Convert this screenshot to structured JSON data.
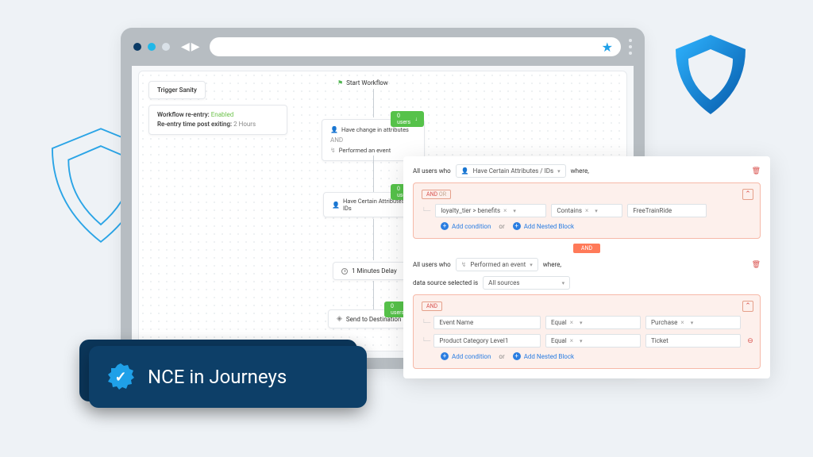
{
  "title_card": {
    "label": "NCE in Journeys"
  },
  "workflow": {
    "trigger_label": "Trigger Sanity",
    "reentry_label": "Workflow re-entry:",
    "reentry_value": "Enabled",
    "reentry_time_label": "Re-entry time post exiting:",
    "reentry_time_value": "2 Hours",
    "start_label": "Start Workflow",
    "node1": {
      "users_count": "0 users",
      "line1": "Have change in attributes",
      "logic": "AND",
      "line2": "Performed an event"
    },
    "node2": {
      "users_count": "0 users",
      "line1": "Have Certain Attributes / IDs"
    },
    "node3": {
      "label": "1 Minutes Delay"
    },
    "node4": {
      "users_count": "0 users",
      "label": "Send to Destination"
    }
  },
  "rules": {
    "all_users_who": "All users who",
    "where": "where,",
    "top_dropdown": "Have Certain Attributes / IDs",
    "block1": {
      "and": "AND",
      "or": "OR",
      "field": "loyalty_tier > benefits",
      "op": "Contains",
      "value": "FreeTrainRide",
      "add_condition": "Add condition",
      "or_txt": "or",
      "add_nested": "Add Nested Block"
    },
    "divider": "AND",
    "second_dropdown": "Performed an event",
    "source_label": "data source selected is",
    "source_value": "All sources",
    "block2": {
      "and": "AND",
      "rows": [
        {
          "name": "Event Name",
          "op": "Equal",
          "value": "Purchase"
        },
        {
          "name": "Product Category Level1",
          "op": "Equal",
          "value": "Ticket"
        }
      ],
      "add_condition": "Add condition",
      "or_txt": "or",
      "add_nested": "Add Nested Block"
    }
  }
}
